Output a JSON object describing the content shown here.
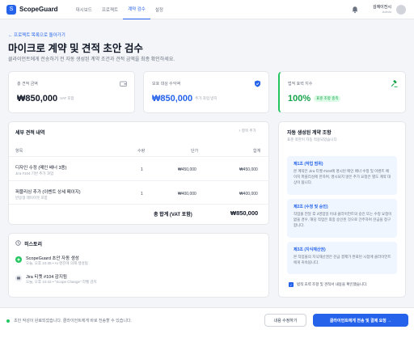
{
  "app": {
    "name": "ScopeGuard",
    "logo_glyph": "S"
  },
  "nav": [
    {
      "label": "대시보드"
    },
    {
      "label": "프로젝트"
    },
    {
      "label": "계약 검수"
    },
    {
      "label": "설정"
    }
  ],
  "active_nav": "계약 검수",
  "user": {
    "name": "김에이전시",
    "role": "Admin"
  },
  "header": {
    "back": "← 프로젝트 목록으로 돌아가기",
    "title": "마이크로 계약 및 견적 초안 검수",
    "description": "클라이언트에게 전송하기 전 자동 생성된 계약 조건과 견적 금액을 최종 확인하세요."
  },
  "stats": {
    "total": {
      "label": "총 견적 금액",
      "value": "₩850,000",
      "suffix": "VAT 포함",
      "icon": "wallet-icon"
    },
    "protected": {
      "label": "보호 대상 수익액",
      "value": "₩850,000",
      "suffix": "추가 과업 방지",
      "icon": "shield-icon"
    },
    "legal": {
      "label": "법적 효력 지수",
      "value": "100%",
      "badge": "표준 조항 충족",
      "icon": "gavel-icon"
    }
  },
  "breakdown": {
    "title": "세부 견적 내역",
    "add_label": "+ 항목 추가",
    "columns": {
      "item": "항목",
      "qty": "수량",
      "unit": "단가",
      "total": "합계"
    },
    "rows": [
      {
        "title": "디자인 수정 (메인 배너 3종)",
        "sub": "Jira #104 기반 추가 과업",
        "qty": "1",
        "unit": "₩450,000",
        "total": "₩450,000"
      },
      {
        "title": "퍼블리싱 추가 (이벤트 상세 페이지)",
        "sub": "반응형 레이아웃 포함",
        "qty": "1",
        "unit": "₩400,000",
        "total": "₩400,000"
      }
    ],
    "total_label": "총 합계 (VAT 포함)",
    "total_value": "₩850,000"
  },
  "history": {
    "title": "히스토리",
    "items": [
      {
        "title": "ScopeGuard 초안 자동 생성",
        "sub": "오늘, 오후 10:45 • AI 엔진에 의해 생성됨"
      },
      {
        "title": "Jira 티켓 #104 감지됨",
        "sub": "오늘, 오후 10:42 • \"Scope Change\" 라벨 감지"
      }
    ]
  },
  "clauses": {
    "title": "자동 생성된 계약 조항",
    "intro": "표준 약관이 자동 적용되었습니다.",
    "items": [
      {
        "title": "제1조 (작업 범위)",
        "body": "본 계약은 Jira 티켓 #104에 명시된 메인 배너 수정 및 이벤트 페이지 퍼블리싱에 한하며, 명시되지 않은 추가 요청은 별도 계약 대상이 됩니다."
      },
      {
        "title": "제2조 (수정 및 승인)",
        "body": "작업물 전달 후 3영업일 이내 클라이언트의 승인 또는 수정 요청이 없을 경우, 해당 작업은 최종 승인된 것으로 간주하며 잔금을 청구합니다."
      },
      {
        "title": "제3조 (지식재산권)",
        "body": "본 작업물의 지식재산권은 잔금 결제가 완료된 시점에 클라이언트에게 귀속됩니다."
      }
    ],
    "agree_label": "법적 효력 조항 및 견적서 내용을 확인했습니다."
  },
  "footer": {
    "note": "초안 작성이 완료되었습니다. 클라이언트에게 바로 전송할 수 있습니다.",
    "secondary": "내용 수정하기",
    "primary": "클라이언트에게 전송 및 결제 요청 →"
  },
  "colors": {
    "accent": "#2563eb",
    "success": "#16a34a"
  }
}
